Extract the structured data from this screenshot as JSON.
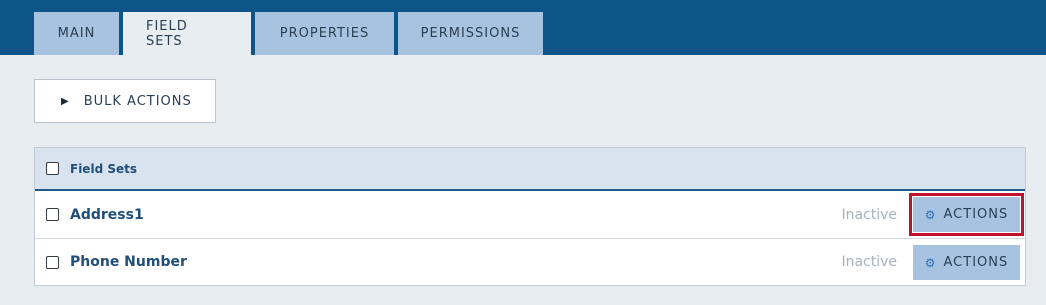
{
  "tabs": [
    {
      "label": "MAIN",
      "active": false
    },
    {
      "label": "FIELD SETS",
      "active": true
    },
    {
      "label": "PROPERTIES",
      "active": false
    },
    {
      "label": "PERMISSIONS",
      "active": false
    }
  ],
  "bulk_actions": {
    "label": "BULK ACTIONS",
    "icon": "play-icon"
  },
  "table": {
    "header_label": "Field Sets",
    "rows": [
      {
        "name": "Address1",
        "status": "Inactive",
        "action_label": "ACTIONS",
        "highlighted": true
      },
      {
        "name": "Phone Number",
        "status": "Inactive",
        "action_label": "ACTIONS",
        "highlighted": false
      }
    ]
  },
  "colors": {
    "topbar": "#0d5489",
    "tab_inactive": "#a7c3e0",
    "accent_text": "#1f4e79",
    "highlight": "#c1122b"
  }
}
